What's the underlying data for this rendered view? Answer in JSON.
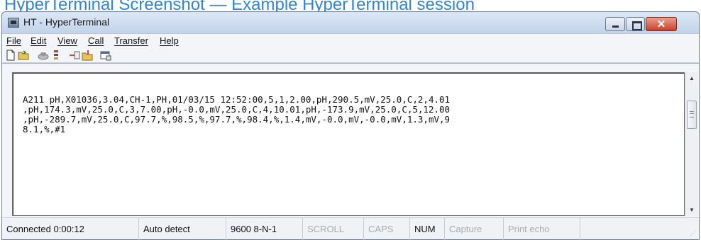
{
  "caption": "HyperTerminal Screenshot — Example HyperTerminal session",
  "window": {
    "title": "HT - HyperTerminal"
  },
  "menu": [
    "File",
    "Edit",
    "View",
    "Call",
    "Transfer",
    "Help"
  ],
  "toolbar": {
    "icons": [
      "new-document-icon",
      "open-folder-icon",
      "phone-icon",
      "disconnect-icon",
      "send-icon",
      "receive-icon",
      "properties-icon"
    ]
  },
  "terminal": {
    "lines": [
      "A211 pH,X01036,3.04,CH-1,PH,01/03/15 12:52:00,5,1,2.00,pH,290.5,mV,25.0,C,2,4.01",
      ",pH,174.3,mV,25.0,C,3,7.00,pH,-0.0,mV,25.0,C,4,10.01,pH,-173.9,mV,25.0,C,5,12.00",
      ",pH,-289.7,mV,25.0,C,97.7,%,98.5,%,97.7,%,98.4,%,1.4,mV,-0.0,mV,-0.0,mV,1.3,mV,9",
      "8.1,%,#1"
    ]
  },
  "status": {
    "connected": "Connected 0:00:12",
    "detect": "Auto detect",
    "settings": "9600 8-N-1",
    "scroll": "SCROLL",
    "caps": "CAPS",
    "num": "NUM",
    "capture": "Capture",
    "print_echo": "Print echo"
  },
  "colors": {
    "caption_text": "#2f86d8",
    "close_button": "#c9422b"
  }
}
